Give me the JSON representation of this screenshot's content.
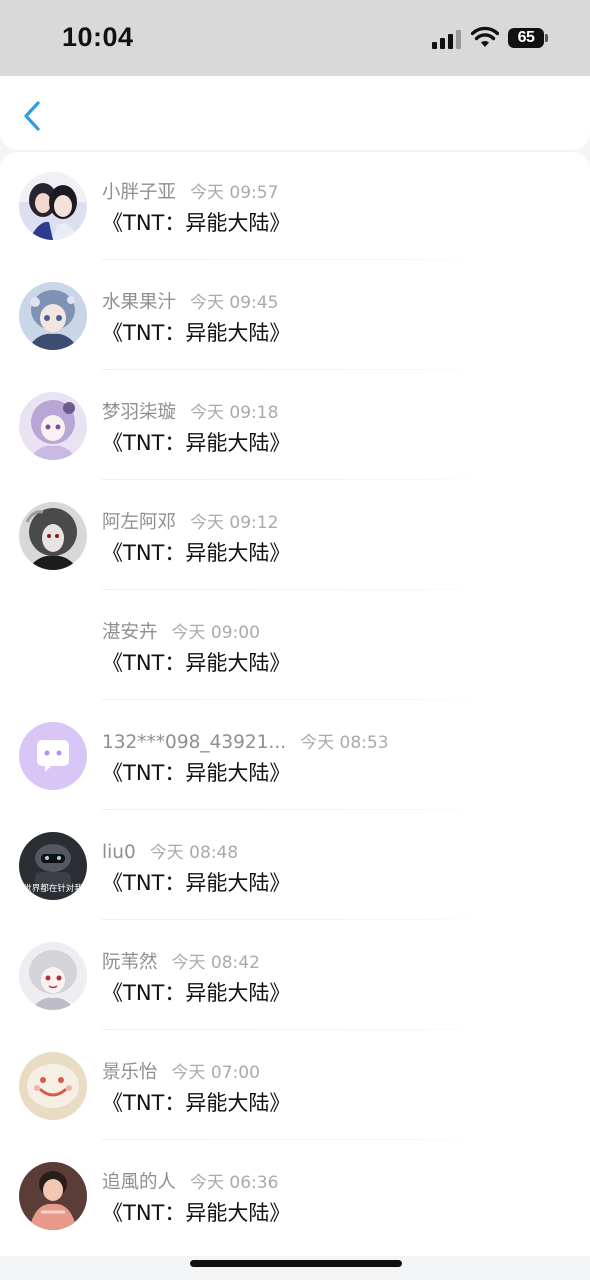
{
  "status_bar": {
    "time": "10:04",
    "battery": "65"
  },
  "header": {
    "back_icon": "chevron-left-icon",
    "accent_color": "#2f9ae6"
  },
  "messages": [
    {
      "name": "小胖子亚",
      "time": "今天 09:57",
      "text": "《TNT：异能大陆》",
      "avatar": "photo"
    },
    {
      "name": "水果果汁",
      "time": "今天 09:45",
      "text": "《TNT：异能大陆》",
      "avatar": "anime-girl"
    },
    {
      "name": "梦羽柒璇",
      "time": "今天 09:18",
      "text": "《TNT：异能大陆》",
      "avatar": "anime-girl"
    },
    {
      "name": "阿左阿邓",
      "time": "今天 09:12",
      "text": "《TNT：异能大陆》",
      "avatar": "dark-portrait"
    },
    {
      "name": "湛安卉",
      "time": "今天 09:00",
      "text": "《TNT：异能大陆》",
      "avatar": "none"
    },
    {
      "name": "132***098_43921...",
      "time": "今天 08:53",
      "text": "《TNT：异能大陆》",
      "avatar": "chat-bubble-icon"
    },
    {
      "name": "liu0",
      "time": "今天 08:48",
      "text": "《TNT：异能大陆》",
      "avatar": "robot",
      "avatar_text": "世界都在针对我"
    },
    {
      "name": "阮苇然",
      "time": "今天 08:42",
      "text": "《TNT：异能大陆》",
      "avatar": "anime-girl"
    },
    {
      "name": "景乐怡",
      "time": "今天 07:00",
      "text": "《TNT：异能大陆》",
      "avatar": "smiley"
    },
    {
      "name": "追風的人",
      "time": "今天 06:36",
      "text": "《TNT：异能大陆》",
      "avatar": "photo"
    }
  ]
}
